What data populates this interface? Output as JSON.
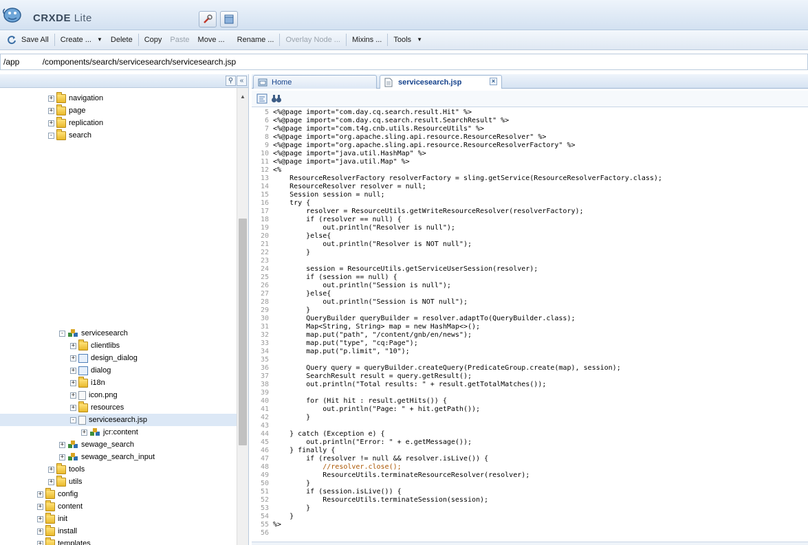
{
  "app": {
    "title_main": "CRXDE",
    "title_sub": "Lite"
  },
  "toolbar": {
    "save_all": "Save All",
    "create": "Create ...",
    "delete": "Delete",
    "copy": "Copy",
    "paste": "Paste",
    "move": "Move ...",
    "rename": "Rename ...",
    "overlay": "Overlay Node ...",
    "mixins": "Mixins ...",
    "tools": "Tools"
  },
  "path": {
    "value": "/app          /components/search/servicesearch/servicesearch.jsp"
  },
  "tree": [
    {
      "label": "navigation",
      "type": "folder",
      "expander": "+"
    },
    {
      "label": "page",
      "type": "folder",
      "expander": "+"
    },
    {
      "label": "replication",
      "type": "folder",
      "expander": "+"
    },
    {
      "label": "search",
      "type": "folder",
      "expander": "-"
    },
    {
      "label": "servicesearch",
      "type": "component",
      "expander": "-"
    },
    {
      "label": "clientlibs",
      "type": "folder",
      "expander": "+"
    },
    {
      "label": "design_dialog",
      "type": "dialog",
      "expander": "+"
    },
    {
      "label": "dialog",
      "type": "dialog",
      "expander": "+"
    },
    {
      "label": "i18n",
      "type": "folder",
      "expander": "+"
    },
    {
      "label": "icon.png",
      "type": "file",
      "expander": "+"
    },
    {
      "label": "resources",
      "type": "folder",
      "expander": "+"
    },
    {
      "label": "servicesearch.jsp",
      "type": "file",
      "expander": "-"
    },
    {
      "label": "jcr:content",
      "type": "component",
      "expander": "+"
    },
    {
      "label": "sewage_search",
      "type": "component",
      "expander": "+"
    },
    {
      "label": "sewage_search_input",
      "type": "component",
      "expander": "+"
    },
    {
      "label": "tools",
      "type": "folder",
      "expander": "+"
    },
    {
      "label": "utils",
      "type": "folder",
      "expander": "+"
    },
    {
      "label": "config",
      "type": "folder",
      "expander": "+"
    },
    {
      "label": "content",
      "type": "folder",
      "expander": "+"
    },
    {
      "label": "init",
      "type": "folder",
      "expander": "+"
    },
    {
      "label": "install",
      "type": "folder",
      "expander": "+"
    },
    {
      "label": "templates",
      "type": "folder",
      "expander": "+"
    }
  ],
  "tabs": [
    {
      "label": "Home"
    },
    {
      "label": "servicesearch.jsp",
      "close": "×"
    }
  ],
  "code": {
    "line_numbers": [
      "5",
      "6",
      "7",
      "8",
      "9",
      "10",
      "11",
      "12",
      "13",
      "14",
      "15",
      "16",
      "17",
      "18",
      "19",
      "20",
      "21",
      "22",
      "23",
      "24",
      "25",
      "26",
      "27",
      "28",
      "29",
      "30",
      "31",
      "32",
      "33",
      "34",
      "35",
      "36",
      "37",
      "38",
      "39",
      "40",
      "41",
      "42",
      "43",
      "44",
      "45",
      "46",
      "47",
      "48",
      "49",
      "50",
      "51",
      "52",
      "53",
      "54",
      "55",
      "56"
    ],
    "lines": [
      "<%@page import=\"com.day.cq.search.result.Hit\" %>",
      "<%@page import=\"com.day.cq.search.result.SearchResult\" %>",
      "<%@page import=\"com.t4g.cnb.utils.ResourceUtils\" %>",
      "<%@page import=\"org.apache.sling.api.resource.ResourceResolver\" %>",
      "<%@page import=\"org.apache.sling.api.resource.ResourceResolverFactory\" %>",
      "<%@page import=\"java.util.HashMap\" %>",
      "<%@page import=\"java.util.Map\" %>",
      "<%",
      "    ResourceResolverFactory resolverFactory = sling.getService(ResourceResolverFactory.class);",
      "    ResourceResolver resolver = null;",
      "    Session session = null;",
      "    try {",
      "        resolver = ResourceUtils.getWriteResourceResolver(resolverFactory);",
      "        if (resolver == null) {",
      "            out.println(\"Resolver is null\");",
      "        }else{",
      "            out.println(\"Resolver is NOT null\");",
      "        }",
      "",
      "        session = ResourceUtils.getServiceUserSession(resolver);",
      "        if (session == null) {",
      "            out.println(\"Session is null\");",
      "        }else{",
      "            out.println(\"Session is NOT null\");",
      "        }",
      "        QueryBuilder queryBuilder = resolver.adaptTo(QueryBuilder.class);",
      "        Map<String, String> map = new HashMap<>();",
      "        map.put(\"path\", \"/content/gnb/en/news\");",
      "        map.put(\"type\", \"cq:Page\");",
      "        map.put(\"p.limit\", \"10\");",
      "",
      "        Query query = queryBuilder.createQuery(PredicateGroup.create(map), session);",
      "        SearchResult result = query.getResult();",
      "        out.println(\"Total results: \" + result.getTotalMatches());",
      "",
      "        for (Hit hit : result.getHits()) {",
      "            out.println(\"Page: \" + hit.getPath());",
      "        }",
      "",
      "    } catch (Exception e) {",
      "        out.println(\"Error: \" + e.getMessage());",
      "    } finally {",
      "        if (resolver != null && resolver.isLive()) {",
      "            //resolver.close();",
      "            ResourceUtils.terminateResourceResolver(resolver);",
      "        }",
      "        if (session.isLive()) {",
      "            ResourceUtils.terminateSession(session);",
      "        }",
      "    }",
      "%>",
      ""
    ]
  }
}
